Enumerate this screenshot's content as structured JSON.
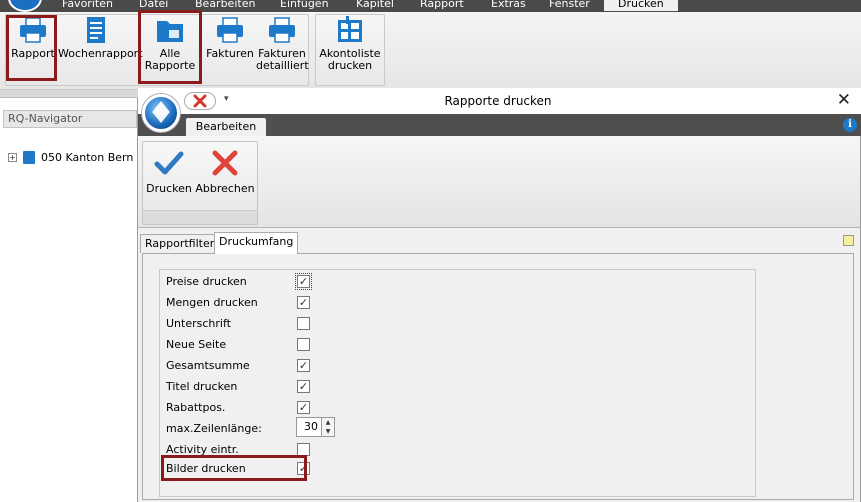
{
  "menubar": {
    "tabs": [
      "Favoriten",
      "Datei",
      "Bearbeiten",
      "Einfügen",
      "Kapitel",
      "Rapport",
      "Extras",
      "Fenster",
      "Drucken"
    ],
    "active_tab": "Drucken"
  },
  "ribbon": {
    "buttons": {
      "rapport": "Rapport",
      "wochenrapport": "Wochenrapport",
      "alle_rapporte_1": "Alle",
      "alle_rapporte_2": "Rapporte",
      "fakturen": "Fakturen",
      "fakturen_detailliert_1": "Fakturen",
      "fakturen_detailliert_2": "detailliert",
      "akontoliste_1": "Akontoliste",
      "akontoliste_2": "drucken"
    },
    "icons": [
      "printer-icon",
      "document-list-icon",
      "folder-icon",
      "printer-icon",
      "printer-icon",
      "calculator-icon"
    ],
    "accent_color": "#1e7ac9",
    "highlight_color": "#8b1a1a"
  },
  "navigator": {
    "title": "RQ-Navigator",
    "items": [
      {
        "label": "050 Kanton Bern",
        "expander": "+"
      }
    ]
  },
  "dialog": {
    "title": "Rapporte drucken",
    "close_glyph": "✕",
    "tab": "Bearbeiten",
    "info_glyph": "i",
    "buttons": {
      "drucken": "Drucken",
      "abbrechen": "Abbrechen"
    },
    "page_tabs": [
      "Rapportfilter",
      "Druckumfang"
    ],
    "active_page_tab": "Druckumfang",
    "options": [
      {
        "label": "Preise drucken",
        "checked": true
      },
      {
        "label": "Mengen drucken",
        "checked": true
      },
      {
        "label": "Unterschrift",
        "checked": false
      },
      {
        "label": "Neue Seite",
        "checked": false
      },
      {
        "label": "Gesamtsumme",
        "checked": true
      },
      {
        "label": "Titel drucken",
        "checked": true
      },
      {
        "label": "Rabattpos.",
        "checked": true
      },
      {
        "label": "max.Zeilenlänge:",
        "value": "30"
      },
      {
        "label": "Activity eintr.",
        "checked": false
      },
      {
        "label": "Bilder drucken",
        "checked": true
      }
    ]
  }
}
